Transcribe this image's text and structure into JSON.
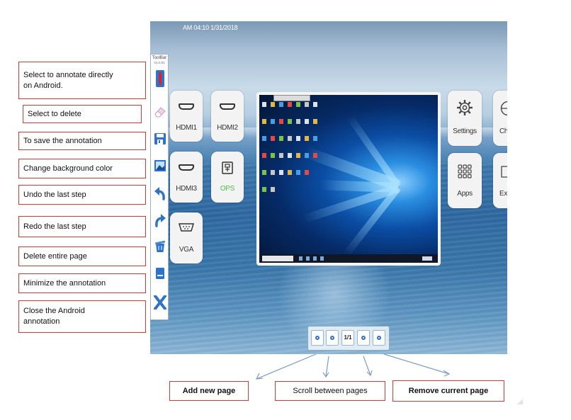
{
  "screen": {
    "status_time": "AM 04:10  1/31/2018"
  },
  "toolbar": {
    "title": "ToolBar",
    "subtitle": "V1.0.01",
    "tools": [
      {
        "name": "pen-icon",
        "color": "#d62828"
      },
      {
        "name": "eraser-icon",
        "color": "#e3b6d0"
      },
      {
        "name": "save-icon",
        "color": "#2f73c9"
      },
      {
        "name": "background-color-icon",
        "color": "#2f73c9"
      },
      {
        "name": "undo-icon",
        "color": "#2f73c9"
      },
      {
        "name": "redo-icon",
        "color": "#2f73c9"
      },
      {
        "name": "delete-page-icon",
        "color": "#2f73c9"
      },
      {
        "name": "minimize-icon",
        "color": "#2f73c9"
      },
      {
        "name": "close-icon",
        "color": "#2f73c9"
      }
    ]
  },
  "sources": {
    "hdmi1": "HDMI1",
    "hdmi2": "HDMI2",
    "hdmi3": "HDMI3",
    "ops": "OPS",
    "vga": "VGA"
  },
  "apps": {
    "settings": "Settings",
    "ch": "Ch",
    "apps": "Apps",
    "ex": "Ex"
  },
  "pager": {
    "counter": "1/1"
  },
  "callouts": [
    "Select to annotate directly on Android.",
    "Select to delete",
    "To save the annotation",
    "Change background color",
    "Undo the last step",
    "Redo the last step",
    "Delete entire page",
    "Minimize the annotation",
    "Close the Android annotation"
  ],
  "bottom_labels": {
    "add_page": "Add new page",
    "scroll": "Scroll between pages",
    "remove_page": "Remove current page"
  },
  "colors": {
    "callout_border": "#d33b3b",
    "accent": "#2f73c9",
    "ops_label": "#4cc24c"
  }
}
